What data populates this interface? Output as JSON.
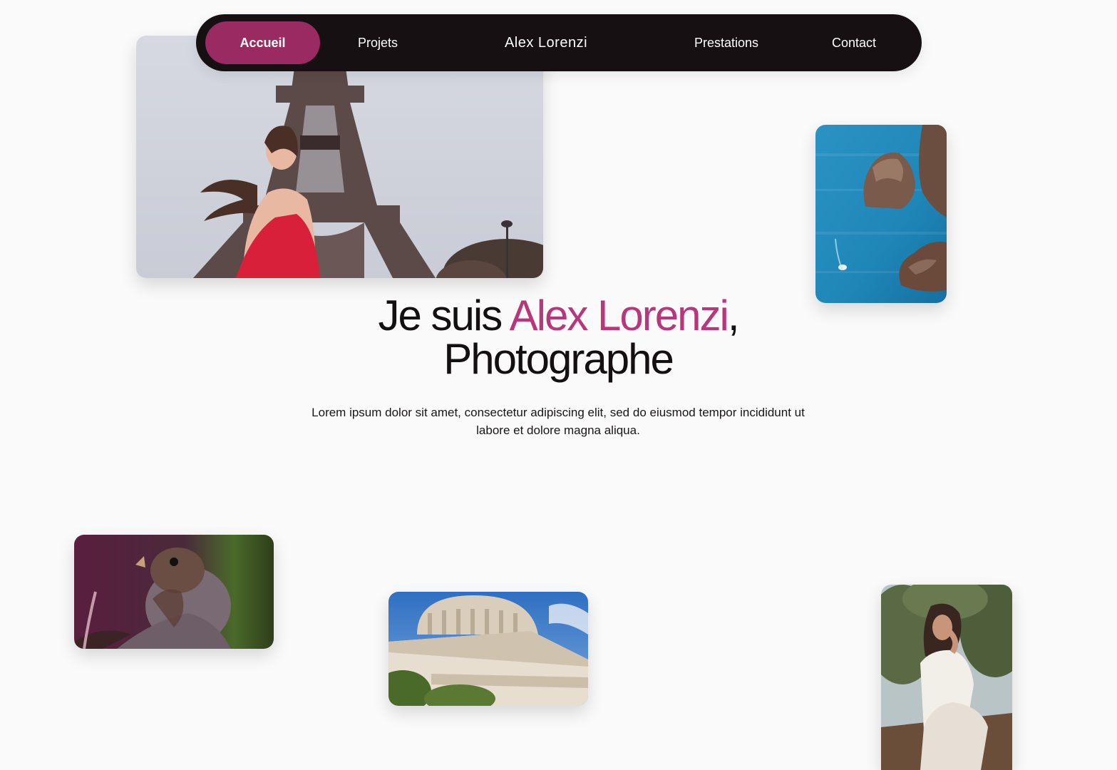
{
  "nav": {
    "items": [
      {
        "label": "Accueil",
        "active": true
      },
      {
        "label": "Projets",
        "active": false
      },
      {
        "label": "Prestations",
        "active": false
      },
      {
        "label": "Contact",
        "active": false
      }
    ],
    "brand": "Alex Lorenzi"
  },
  "hero": {
    "title_prefix": "Je suis ",
    "title_name": "Alex Lorenzi",
    "title_comma": ",",
    "title_line2": "Photographe",
    "subtitle": "Lorem ipsum dolor sit amet, consectetur adipiscing elit, sed do eiusmod tempor incididunt ut labore et dolore magna aliqua."
  },
  "colors": {
    "accent": "#b8367b",
    "nav_active": "#992a62",
    "nav_bg": "#161012",
    "background": "#fafafa"
  },
  "photos": [
    {
      "name": "photo-paris-eiffel",
      "subject": "woman in red dress at Eiffel Tower"
    },
    {
      "name": "photo-coastline",
      "subject": "turquoise sea and rocky coast with boat"
    },
    {
      "name": "photo-sparrow",
      "subject": "sparrow on a branch"
    },
    {
      "name": "photo-dome-building",
      "subject": "domed neoclassical building"
    },
    {
      "name": "photo-portrait-woman",
      "subject": "woman in white outfit among trees"
    }
  ]
}
